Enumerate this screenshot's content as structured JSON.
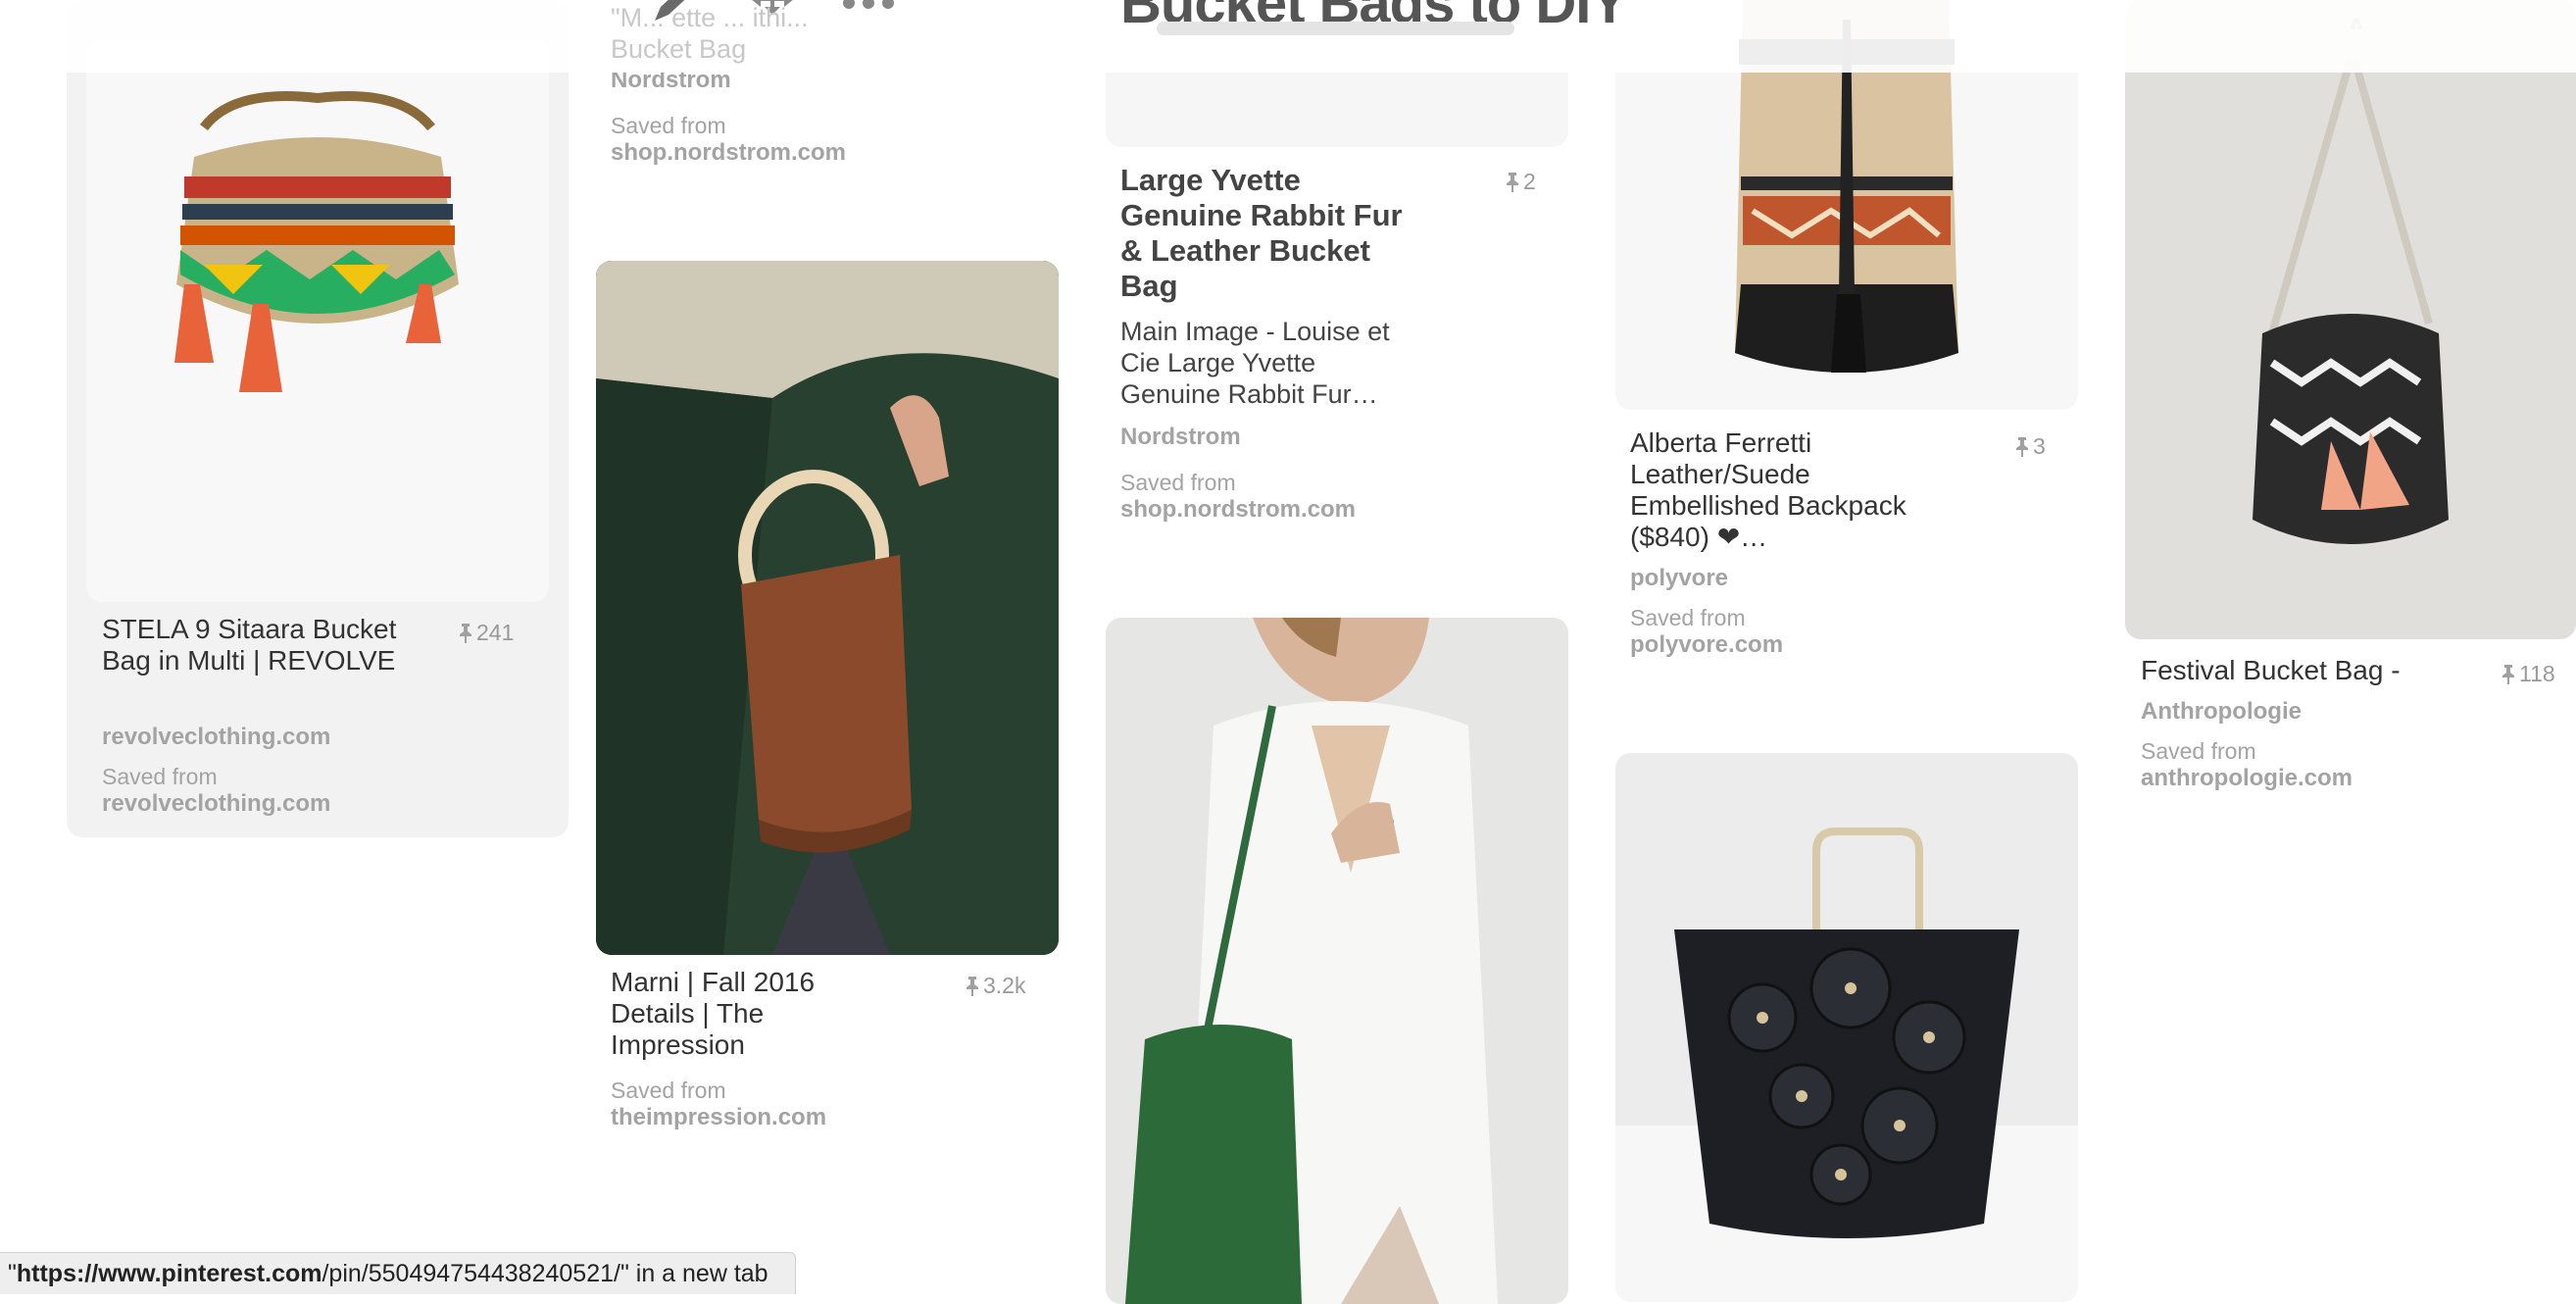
{
  "board": {
    "title": "Bucket Bags to DIY",
    "top_pin_ghost_title": "\"M... ette ... ithi... Bucket Bag\""
  },
  "pins": [
    {
      "id": "stela",
      "title": "STELA 9 Sitaara Bucket Bag in Multi | REVOLVE",
      "repins": "241",
      "source": "revolveclothing.com",
      "saved_from_label": "Saved from",
      "saved_from": "revolveclothing.com"
    },
    {
      "id": "nordstrom-top",
      "title": "\"M... ette ... ithi...\nBucket Bag",
      "source": "Nordstrom",
      "saved_from_label": "Saved from",
      "saved_from": "shop.nordstrom.com"
    },
    {
      "id": "marni",
      "title": "Marni | Fall 2016 Details | The Impression",
      "repins": "3.2k",
      "saved_from_label": "Saved from",
      "saved_from": "theimpression.com"
    },
    {
      "id": "yvette",
      "title": "Large Yvette Genuine Rabbit Fur & Leather Bucket Bag",
      "description": "Main Image - Louise et Cie Large Yvette Genuine Rabbit Fur…",
      "repins": "2",
      "source": "Nordstrom",
      "saved_from_label": "Saved from",
      "saved_from": "shop.nordstrom.com"
    },
    {
      "id": "ferretti",
      "title": "Alberta Ferretti Leather/Suede Embellished Backpack ($840) ❤…",
      "repins": "3",
      "source": "polyvore",
      "saved_from_label": "Saved from",
      "saved_from": "polyvore.com"
    },
    {
      "id": "festival",
      "title": "Festival Bucket Bag -",
      "repins": "118",
      "source": "Anthropologie",
      "saved_from_label": "Saved from",
      "saved_from": "anthropologie.com"
    }
  ],
  "status_bar": {
    "prefix": " \"",
    "host": "https://www.pinterest.com",
    "path": "/pin/550494754438240521/",
    "suffix": "\" in a new tab"
  },
  "colors": {
    "card_bg": "#f2f2f2",
    "muted_text": "#a3a3a3"
  }
}
